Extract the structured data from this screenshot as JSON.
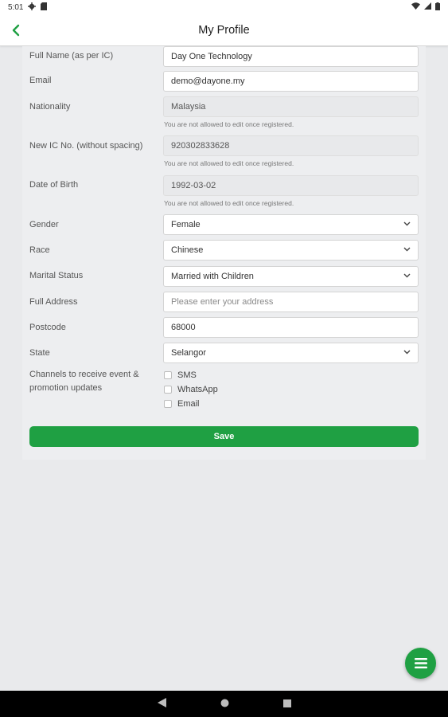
{
  "status_bar": {
    "time": "5:01",
    "icons": [
      "gear-icon",
      "sd-card-icon",
      "wifi-icon",
      "signal-icon",
      "battery-icon"
    ]
  },
  "app_bar": {
    "title": "My Profile",
    "back_icon": "chevron-left-icon"
  },
  "colors": {
    "accent": "#1fa043",
    "background": "#e9eaec"
  },
  "form": {
    "full_name": {
      "label": "Full Name (as per IC)",
      "value": "Day One Technology"
    },
    "email": {
      "label": "Email",
      "value": "demo@dayone.my"
    },
    "nationality": {
      "label": "Nationality",
      "value": "Malaysia",
      "hint": "You are not allowed to edit once registered."
    },
    "ic_no": {
      "label": "New IC No. (without spacing)",
      "value": "920302833628",
      "hint": "You are not allowed to edit once registered."
    },
    "dob": {
      "label": "Date of Birth",
      "value": "1992-03-02",
      "hint": "You are not allowed to edit once registered."
    },
    "gender": {
      "label": "Gender",
      "value": "Female"
    },
    "race": {
      "label": "Race",
      "value": "Chinese"
    },
    "marital_status": {
      "label": "Marital Status",
      "value": "Married with Children"
    },
    "address": {
      "label": "Full Address",
      "placeholder": "Please enter your address"
    },
    "postcode": {
      "label": "Postcode",
      "value": "68000"
    },
    "state": {
      "label": "State",
      "value": "Selangor"
    },
    "channels": {
      "label": "Channels to receive event & promotion updates",
      "options": [
        {
          "label": "SMS",
          "checked": false
        },
        {
          "label": "WhatsApp",
          "checked": false
        },
        {
          "label": "Email",
          "checked": false
        }
      ]
    },
    "save_label": "Save"
  },
  "fab_icon": "menu-icon",
  "nav_bar": {
    "icons": [
      "back-triangle-icon",
      "home-circle-icon",
      "recents-square-icon"
    ]
  }
}
